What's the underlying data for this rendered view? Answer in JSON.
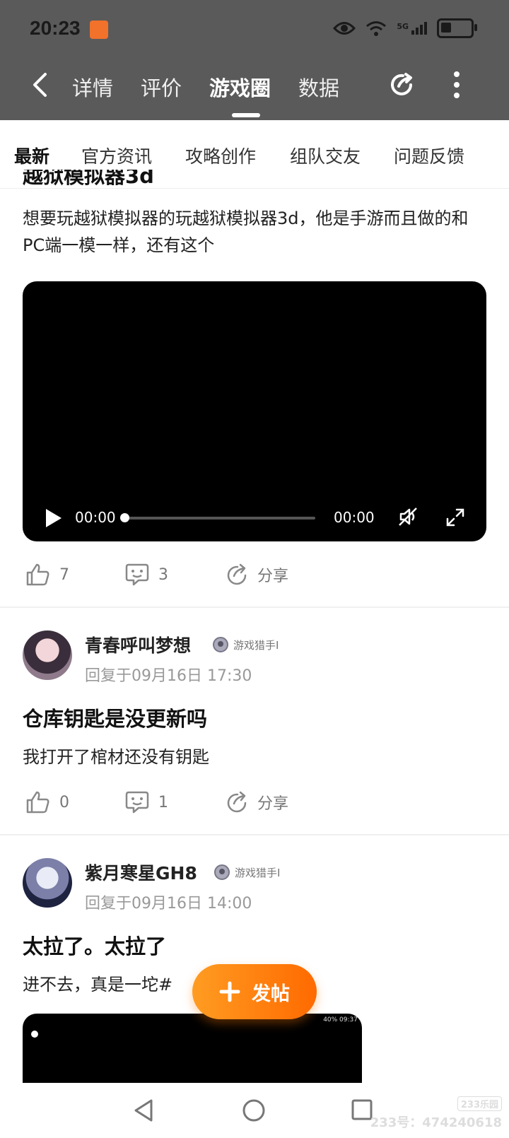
{
  "status": {
    "time": "20:23",
    "network": "5G"
  },
  "header": {
    "tabs": [
      "详情",
      "评价",
      "游戏圈",
      "数据"
    ],
    "active_tab": "游戏圈"
  },
  "subtabs": [
    "最新",
    "官方资讯",
    "攻略创作",
    "组队交友",
    "问题反馈"
  ],
  "post1": {
    "title_partial": "越狱模拟器3d",
    "body": "想要玩越狱模拟器的玩越狱模拟器3d，他是手游而且做的和PC端一模一样，还有这个",
    "video": {
      "current": "00:00",
      "duration": "00:00",
      "progress": 0
    },
    "likes": "7",
    "comments": "3",
    "share_label": "分享"
  },
  "post2": {
    "username": "青春呼叫梦想",
    "badge": "游戏猎手I",
    "meta": "回复于09月16日 17:30",
    "title": "仓库钥匙是没更新吗",
    "body": "我打开了棺材还没有钥匙",
    "likes": "0",
    "comments": "1",
    "share_label": "分享"
  },
  "post3": {
    "username": "紫月寒星GH8",
    "badge": "游戏猎手I",
    "meta": "回复于09月16日 14:00",
    "title": "太拉了。太拉了",
    "body": "进不去，真是一坨#",
    "video_status": "40% 09:37"
  },
  "fab": {
    "label": "发帖"
  },
  "watermark": {
    "logo": "233乐园",
    "text": "233号：474240618"
  },
  "colors": {
    "accent": "#ff7a10",
    "header_bg": "#5a5a5a"
  }
}
